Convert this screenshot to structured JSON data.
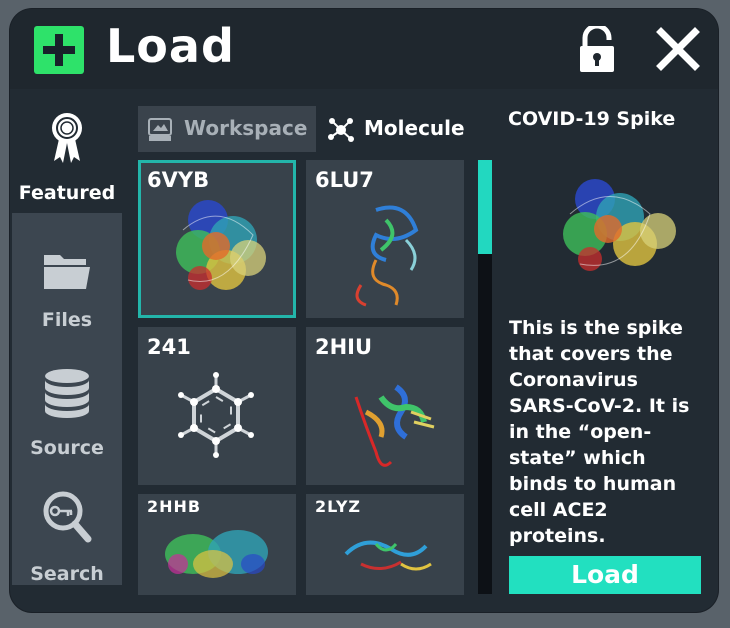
{
  "header": {
    "title": "Load"
  },
  "sidebar": {
    "items": [
      {
        "label": "Featured",
        "icon": "ribbon-award-icon",
        "active": true
      },
      {
        "label": "Files",
        "icon": "folder-icon",
        "active": false
      },
      {
        "label": "Source",
        "icon": "database-icon",
        "active": false
      },
      {
        "label": "Search",
        "icon": "search-key-icon",
        "active": false
      }
    ]
  },
  "tabs": [
    {
      "label": "Workspace",
      "icon": "nano-workspace-icon",
      "active": false
    },
    {
      "label": "Molecule",
      "icon": "molecule-icon",
      "active": true
    }
  ],
  "grid": {
    "items": [
      {
        "name": "6VYB",
        "selected": true
      },
      {
        "name": "6LU7",
        "selected": false
      },
      {
        "name": "241",
        "selected": false
      },
      {
        "name": "2HIU",
        "selected": false
      },
      {
        "name": "2HHB",
        "selected": false
      },
      {
        "name": "2LYZ",
        "selected": false
      }
    ]
  },
  "detail": {
    "title": "COVID-19 Spike",
    "description": "This is the spike that covers the Coronavirus SARS-CoV-2. It is in the “open-state” which binds to human cell ACE2 proteins.",
    "load_label": "Load"
  },
  "colors": {
    "accent": "#22e0c0",
    "plus_green": "#2ee26a",
    "panel": "#222b33",
    "selection": "#23b5aa"
  }
}
